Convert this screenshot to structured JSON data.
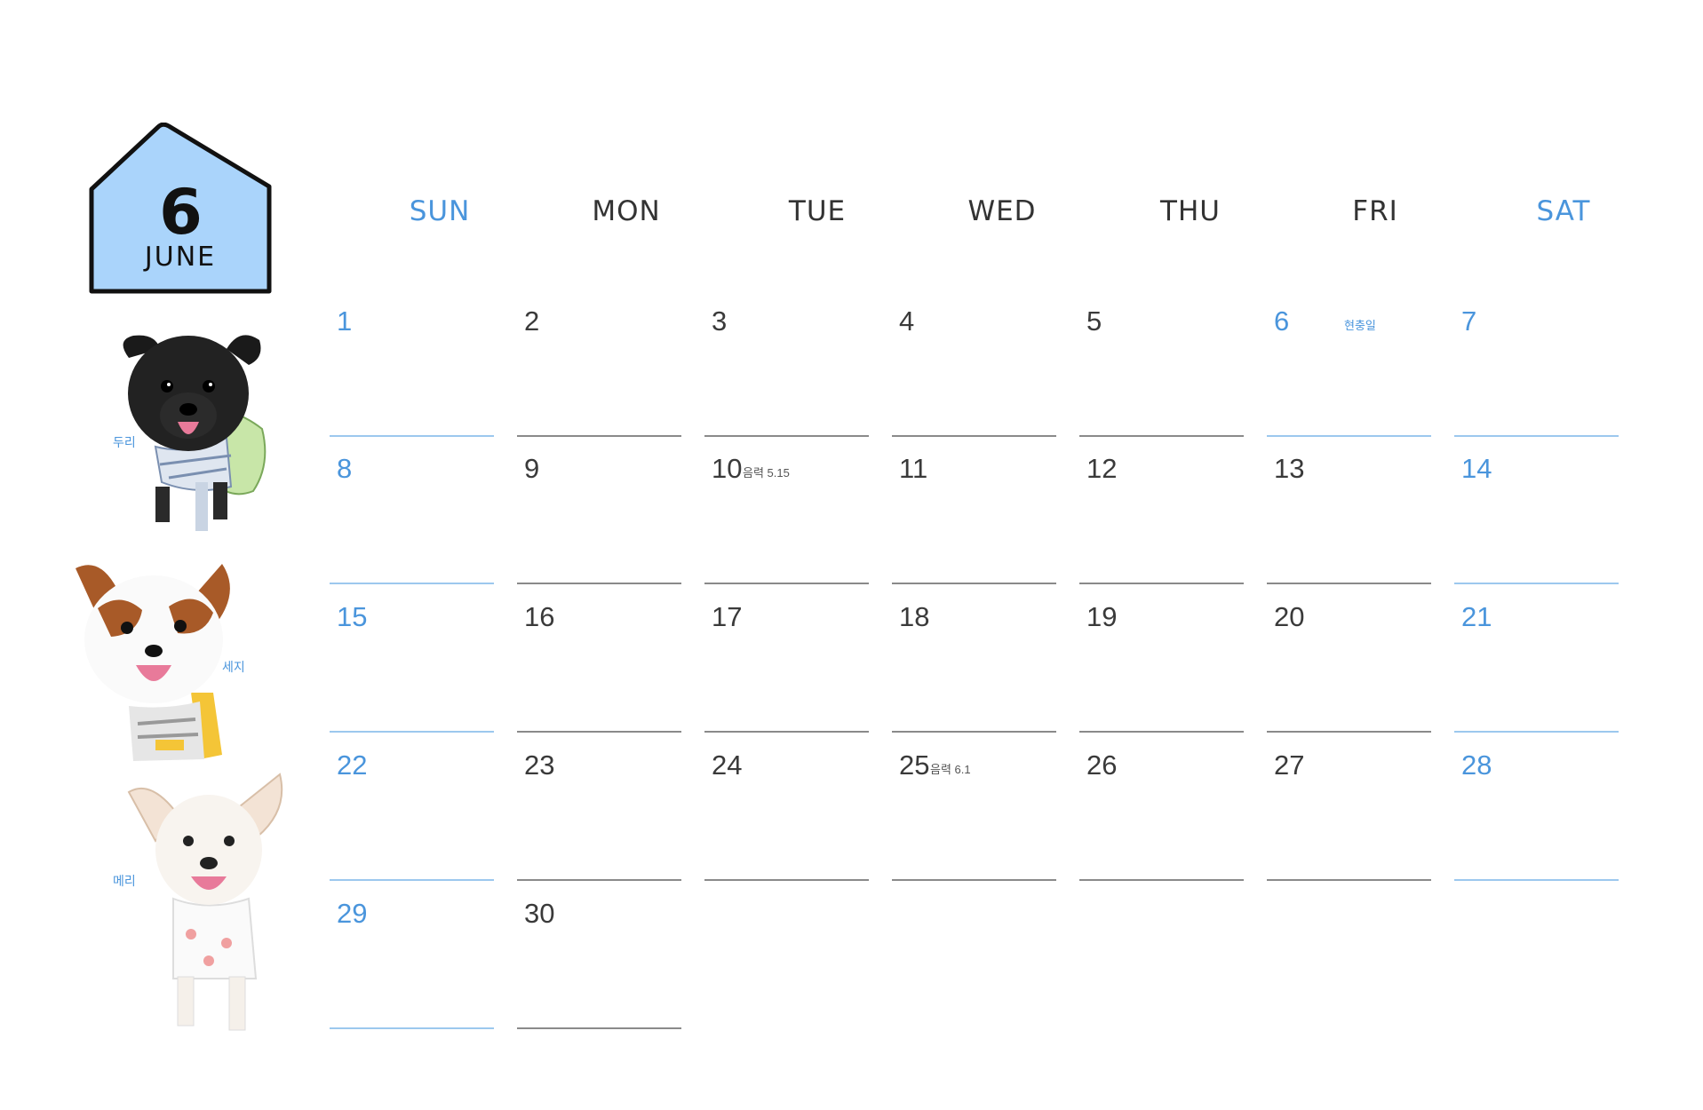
{
  "badge": {
    "number": "6",
    "month": "JUNE",
    "fill": "#aad4fb"
  },
  "dogs": [
    {
      "name": "두리"
    },
    {
      "name": "세지"
    },
    {
      "name": "메리"
    }
  ],
  "weekdays": [
    "SUN",
    "MON",
    "TUE",
    "WED",
    "THU",
    "FRI",
    "SAT"
  ],
  "colors": {
    "weekend": "#4a95dc",
    "weekday": "#333333"
  },
  "weeks": [
    [
      {
        "d": "1"
      },
      {
        "d": "2"
      },
      {
        "d": "3"
      },
      {
        "d": "4"
      },
      {
        "d": "5"
      },
      {
        "d": "6",
        "note": "현충일"
      },
      {
        "d": "7"
      }
    ],
    [
      {
        "d": "8"
      },
      {
        "d": "9"
      },
      {
        "d": "10",
        "note": "음력 5.15"
      },
      {
        "d": "11"
      },
      {
        "d": "12"
      },
      {
        "d": "13"
      },
      {
        "d": "14"
      }
    ],
    [
      {
        "d": "15"
      },
      {
        "d": "16"
      },
      {
        "d": "17"
      },
      {
        "d": "18"
      },
      {
        "d": "19"
      },
      {
        "d": "20"
      },
      {
        "d": "21"
      }
    ],
    [
      {
        "d": "22"
      },
      {
        "d": "23"
      },
      {
        "d": "24"
      },
      {
        "d": "25",
        "note": "음력 6.1"
      },
      {
        "d": "26"
      },
      {
        "d": "27"
      },
      {
        "d": "28"
      }
    ],
    [
      {
        "d": "29"
      },
      {
        "d": "30"
      }
    ]
  ]
}
